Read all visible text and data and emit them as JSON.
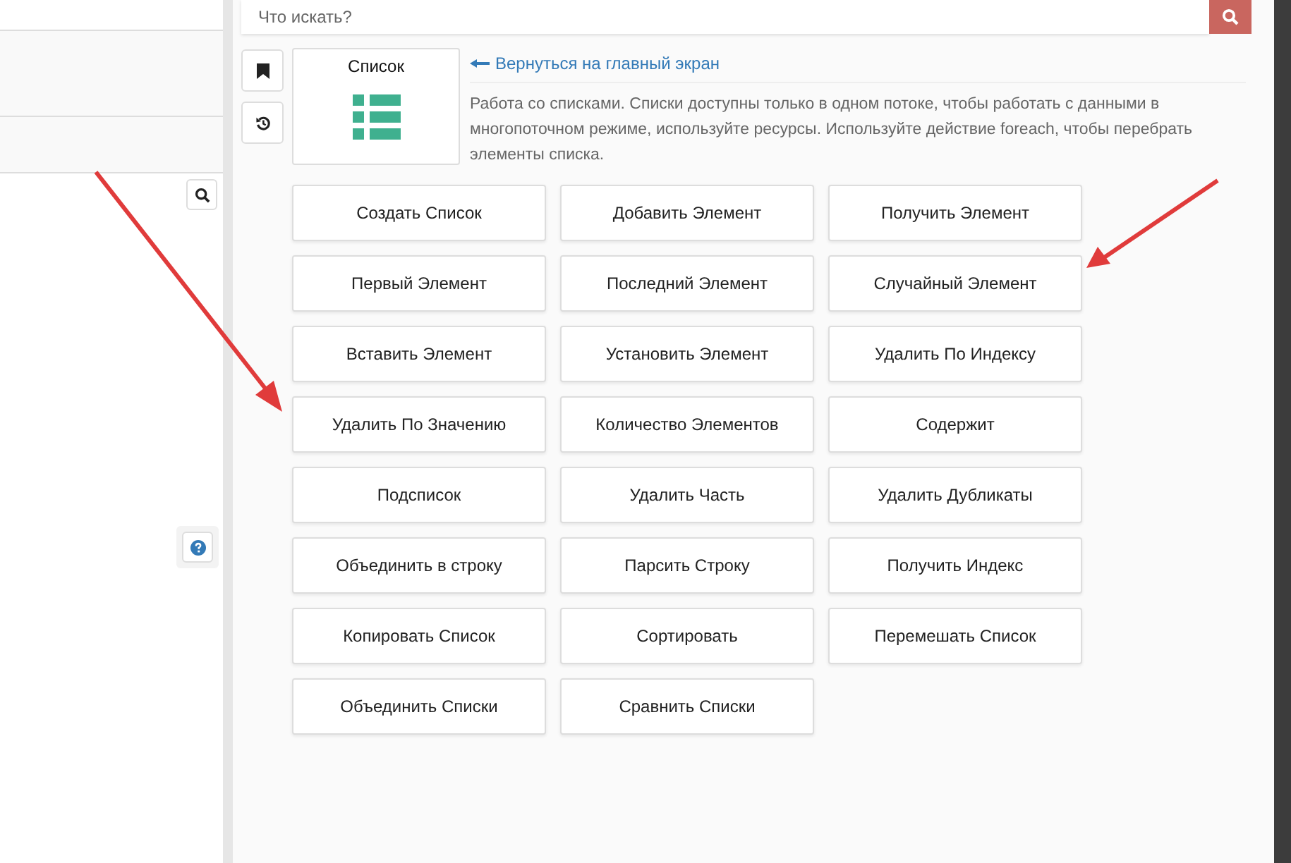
{
  "search": {
    "placeholder": "Что искать?"
  },
  "category": {
    "title": "Список"
  },
  "back_link": "Вернуться на главный экран",
  "description": "Работа со списками. Списки доступны только в одном потоке, чтобы работать с данными в многопоточном режиме, используйте ресурсы. Используйте действие foreach, чтобы перебрать элементы списка.",
  "actions": [
    "Создать Список",
    "Добавить Элемент",
    "Получить Элемент",
    "Первый Элемент",
    "Последний Элемент",
    "Случайный Элемент",
    "Вставить Элемент",
    "Установить Элемент",
    "Удалить По Индексу",
    "Удалить По Значению",
    "Количество Элементов",
    "Содержит",
    "Подсписок",
    "Удалить Часть",
    "Удалить Дубликаты",
    "Объединить в строку",
    "Парсить Строку",
    "Получить Индекс",
    "Копировать Список",
    "Сортировать",
    "Перемешать Список",
    "Объединить Списки",
    "Сравнить Списки"
  ]
}
